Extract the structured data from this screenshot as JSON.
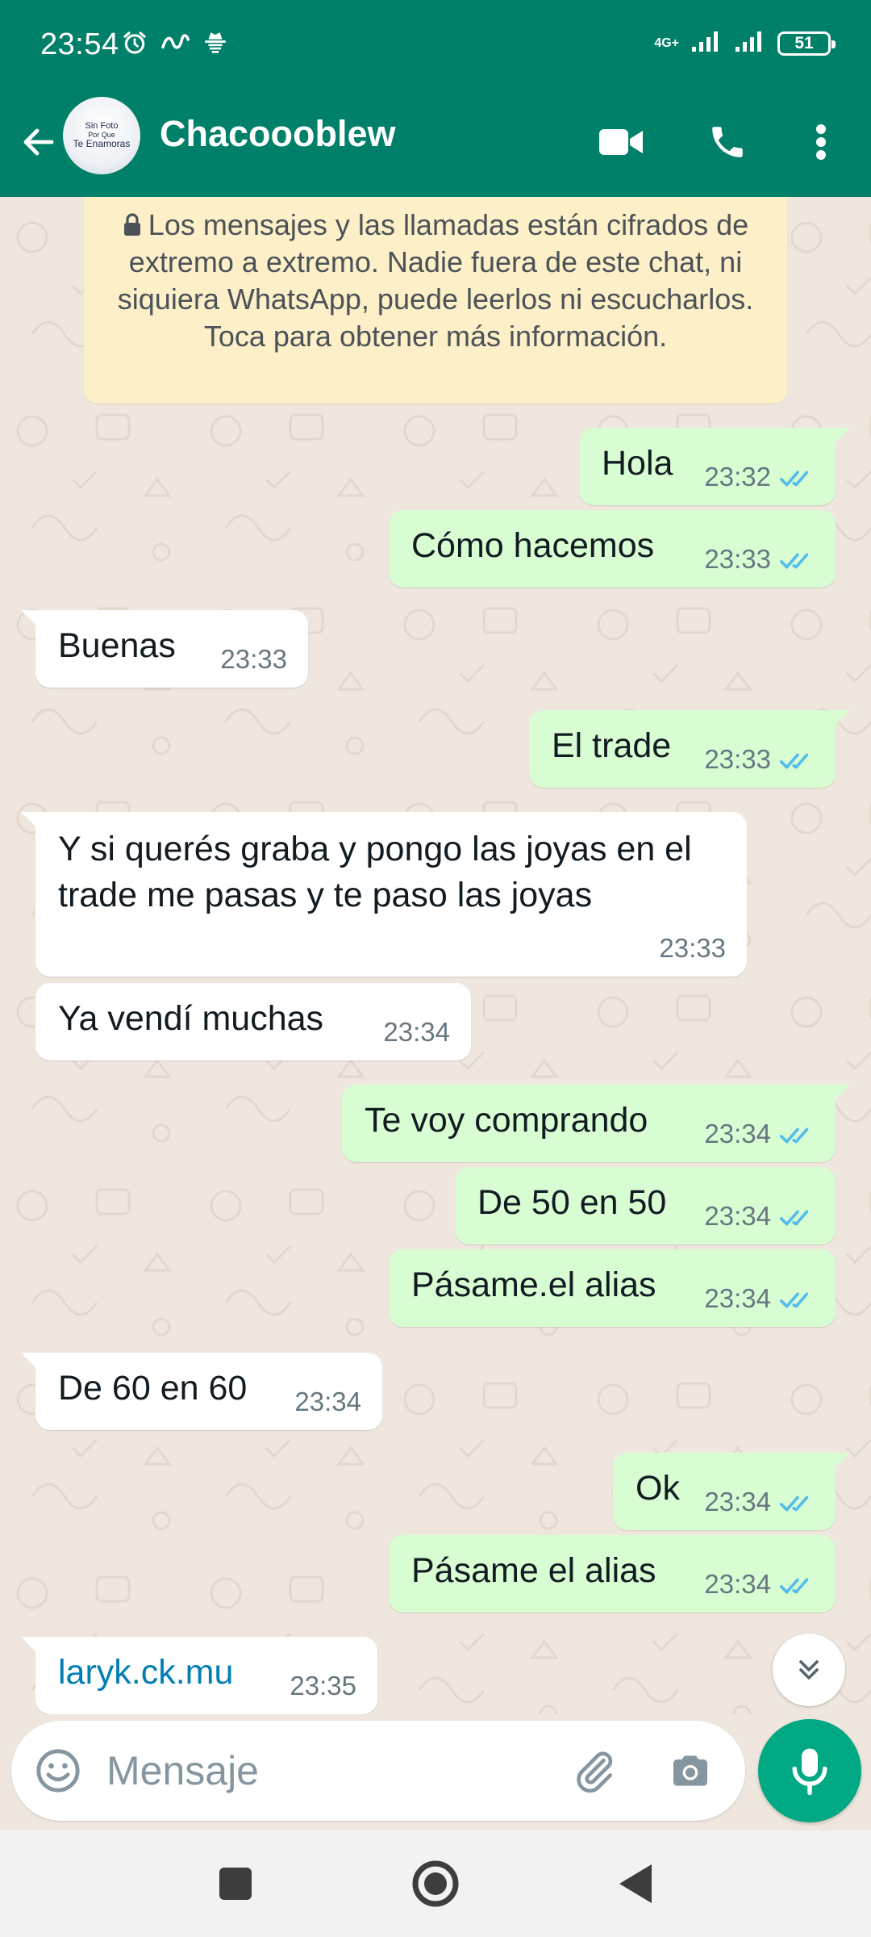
{
  "status_bar": {
    "time": "23:54",
    "network": "4G+",
    "battery": "51",
    "icons": [
      "alarm-icon",
      "link-icon",
      "incognito-icon",
      "signal-icon",
      "signal-icon",
      "battery-icon"
    ]
  },
  "header": {
    "contact_name": "Chacoooblew",
    "avatar_text": [
      "Sin Foto",
      "Por Que",
      "Te Enamoras"
    ],
    "icons": [
      "back-arrow-icon",
      "video-call-icon",
      "phone-call-icon",
      "more-vertical-icon"
    ]
  },
  "notice": {
    "text": "Los mensajes y las llamadas están cifrados de extremo a extremo. Nadie fuera de este chat, ni siquiera WhatsApp, puede leerlos ni escucharlos. Toca para obtener más información."
  },
  "messages": [
    {
      "dir": "out",
      "text": "Hola",
      "time": "23:32",
      "read": true
    },
    {
      "dir": "out",
      "text": "Cómo hacemos",
      "time": "23:33",
      "read": true
    },
    {
      "dir": "in",
      "text": "Buenas",
      "time": "23:33"
    },
    {
      "dir": "out",
      "text": "El trade",
      "time": "23:33",
      "read": true
    },
    {
      "dir": "in",
      "text": "Y si querés graba y pongo las joyas en el trade me pasas y te paso las joyas",
      "time": "23:33"
    },
    {
      "dir": "in",
      "text": "Ya vendí muchas",
      "time": "23:34"
    },
    {
      "dir": "out",
      "text": "Te voy comprando",
      "time": "23:34",
      "read": true
    },
    {
      "dir": "out",
      "text": "De 50 en 50",
      "time": "23:34",
      "read": true
    },
    {
      "dir": "out",
      "text": "Pásame.el alias",
      "time": "23:34",
      "read": true
    },
    {
      "dir": "in",
      "text": "De 60 en 60",
      "time": "23:34"
    },
    {
      "dir": "out",
      "text": "Ok",
      "time": "23:34",
      "read": true
    },
    {
      "dir": "out",
      "text": "Pásame el alias",
      "time": "23:34",
      "read": true
    },
    {
      "dir": "in",
      "text": "laryk.ck.mu",
      "time": "23:35",
      "link": true
    }
  ],
  "input": {
    "placeholder": "Mensaje",
    "icons": [
      "emoji-icon",
      "attach-icon",
      "camera-icon",
      "mic-icon"
    ]
  },
  "colors": {
    "header": "#008069",
    "outgoing_bubble": "#d9fdd3",
    "incoming_bubble": "#ffffff",
    "chat_background": "#efe7de",
    "read_ticks": "#53bdeb",
    "mic_button": "#00a884",
    "notice_background": "#fdefc7",
    "link": "#027eb5"
  }
}
